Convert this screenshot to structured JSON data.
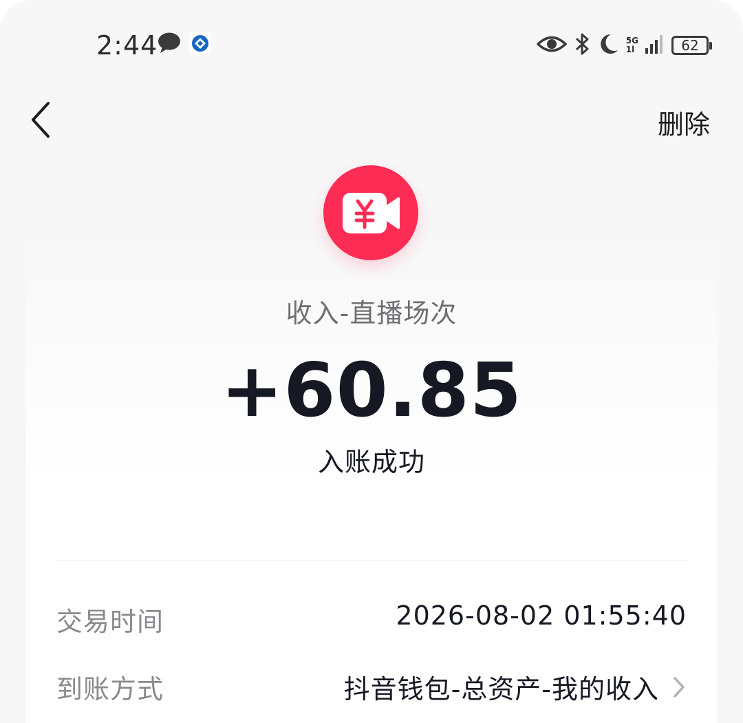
{
  "status_bar": {
    "time": "2:44",
    "left_icons": [
      "chat-bubble-icon",
      "app-badge-icon"
    ],
    "right_icons": [
      "eye-icon",
      "bluetooth-icon",
      "moon-icon",
      "signal-icon"
    ],
    "network_top": "5G",
    "network_bottom": "1l",
    "battery_level": "62"
  },
  "nav": {
    "back_icon": "chevron-left-icon",
    "delete_label": "删除"
  },
  "transaction": {
    "icon": "video-yuan-icon",
    "icon_color": "#fd2c55",
    "category": "收入-直播场次",
    "amount": "+60.85",
    "status": "入账成功"
  },
  "details": [
    {
      "label": "交易时间",
      "value": "2026-08-02 01:55:40"
    },
    {
      "label": "到账方式",
      "value": "抖音钱包-总资产-我的收入"
    }
  ]
}
